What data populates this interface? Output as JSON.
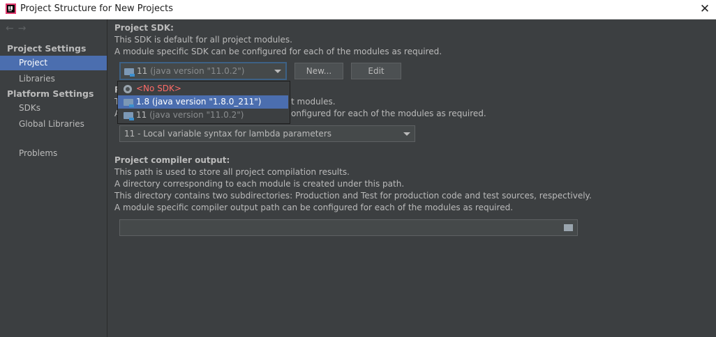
{
  "window": {
    "title": "Project Structure for New Projects",
    "close_glyph": "✕",
    "app_icon": "intellij-logo"
  },
  "sidebar": {
    "nav_back": "←",
    "nav_forward": "→",
    "sections": [
      {
        "heading": "Project Settings",
        "items": [
          "Project",
          "Libraries"
        ]
      },
      {
        "heading": "Platform Settings",
        "items": [
          "SDKs",
          "Global Libraries"
        ]
      }
    ],
    "selected_item": "Project",
    "problems": "Problems"
  },
  "sdk": {
    "heading": "Project SDK:",
    "desc1": "This SDK is default for all project modules.",
    "desc2": "A module specific SDK can be configured for each of the modules as required.",
    "selected_version": "11",
    "selected_detail": "(java version \"11.0.2\")",
    "new_button": "New...",
    "edit_button": "Edit",
    "dropdown_items": [
      {
        "version": "<No SDK>",
        "detail": ""
      },
      {
        "version": "1.8",
        "detail": "(java version \"1.8.0_211\")"
      },
      {
        "version": "11",
        "detail": "(java version \"11.0.2\")"
      }
    ]
  },
  "language_level": {
    "heading_visible": "P",
    "desc1_visible_start": "T",
    "desc1_visible_end": "t modules.",
    "desc2_visible_start": "A",
    "desc2_visible_end": "onfigured for each of the modules as required.",
    "selected": "11 - Local variable syntax for lambda parameters"
  },
  "compiler_output": {
    "heading": "Project compiler output:",
    "lines": [
      "This path is used to store all project compilation results.",
      "A directory corresponding to each module is created under this path.",
      "This directory contains two subdirectories: Production and Test for production code and test sources, respectively.",
      "A module specific compiler output path can be configured for each of the modules as required."
    ],
    "path_value": ""
  },
  "colors": {
    "background": "#3c3f41",
    "selection": "#4b6eaf",
    "no_sdk_text": "#ff6b68"
  }
}
